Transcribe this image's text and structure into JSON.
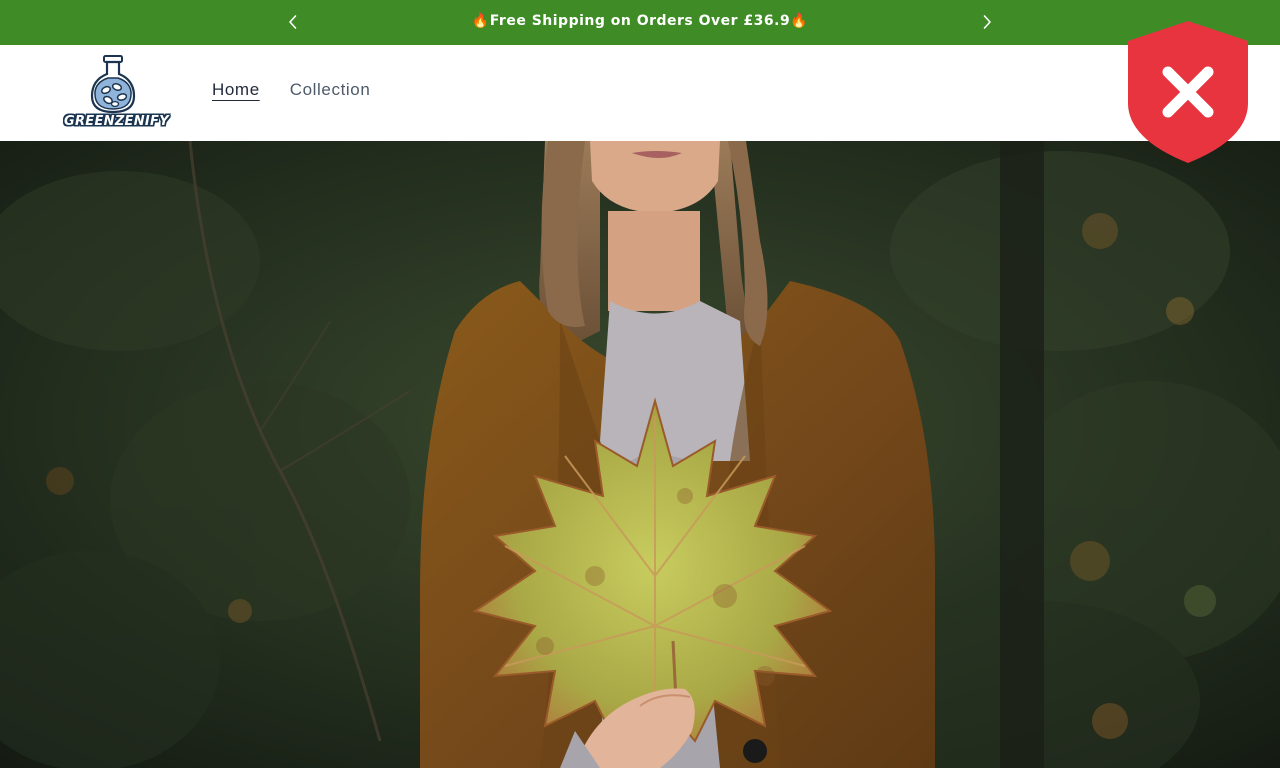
{
  "announcement": {
    "message": "🔥Free Shipping on Orders Over £36.9🔥",
    "background": "#3f8b26",
    "prev_icon": "chevron-left-icon",
    "next_icon": "chevron-right-icon"
  },
  "header": {
    "logo_text": "GREENZENIFY",
    "nav": [
      {
        "label": "Home",
        "active": true
      },
      {
        "label": "Collection",
        "active": false
      }
    ]
  },
  "badge": {
    "icon": "shield-x-icon",
    "color": "#e8343f"
  },
  "hero": {
    "image": "woman-holding-autumn-leaf"
  }
}
